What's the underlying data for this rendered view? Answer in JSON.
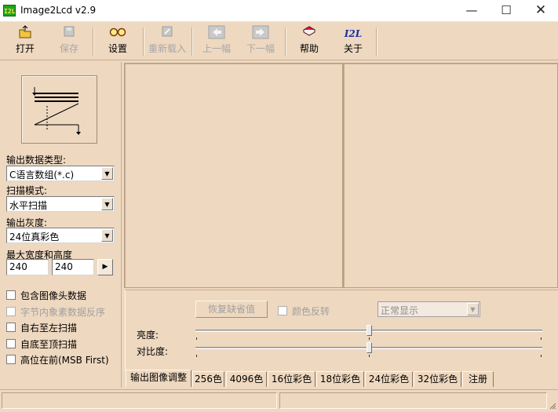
{
  "window": {
    "title": "Image2Lcd v2.9",
    "icon_text": "I2L"
  },
  "toolbar": {
    "open": "打开",
    "save": "保存",
    "settings": "设置",
    "reload": "重新载入",
    "prev": "上一幅",
    "next": "下一幅",
    "help": "帮助",
    "about": "关于",
    "about_icon_text": "I2L"
  },
  "left": {
    "output_type_label": "输出数据类型:",
    "output_type_value": "C语言数组(*.c)",
    "scan_mode_label": "扫描模式:",
    "scan_mode_value": "水平扫描",
    "gray_label": "输出灰度:",
    "gray_value": "24位真彩色",
    "max_size_label": "最大宽度和高度",
    "max_width": "240",
    "max_height": "240",
    "checkboxes": [
      {
        "label": "包含图像头数据",
        "enabled": true
      },
      {
        "label": "字节内象素数据反序",
        "enabled": false
      },
      {
        "label": "自右至左扫描",
        "enabled": true
      },
      {
        "label": "自底至顶扫描",
        "enabled": true
      },
      {
        "label": "高位在前(MSB First)",
        "enabled": true
      }
    ]
  },
  "adjust": {
    "restore_default": "恢复缺省值",
    "invert_color": "颜色反转",
    "display_mode": "正常显示",
    "brightness_label": "亮度:",
    "contrast_label": "对比度:",
    "brightness_level": 0.5,
    "contrast_level": 0.5
  },
  "tabs": [
    "输出图像调整",
    "256色",
    "4096色",
    "16位彩色",
    "18位彩色",
    "24位彩色",
    "32位彩色",
    "注册"
  ],
  "colors": {
    "background": "#eed8c0",
    "title_bg": "#ffffff",
    "icon_green": "#1ea51e"
  }
}
